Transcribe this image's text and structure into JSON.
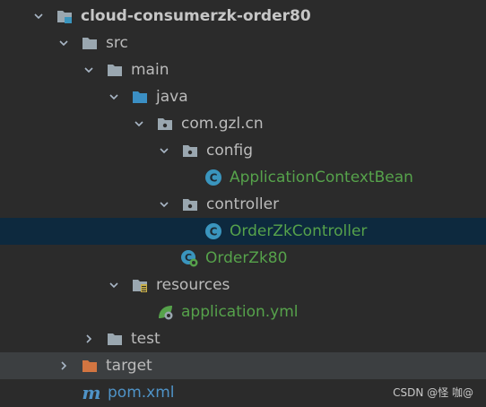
{
  "project_tree": {
    "module": {
      "label": "cloud-consumerzk-order80"
    },
    "src": {
      "label": "src"
    },
    "main": {
      "label": "main"
    },
    "java": {
      "label": "java"
    },
    "package": {
      "label": "com.gzl.cn"
    },
    "config": {
      "label": "config"
    },
    "application_context_bean": {
      "label": "ApplicationContextBean"
    },
    "controller": {
      "label": "controller"
    },
    "order_zk_controller": {
      "label": "OrderZkController"
    },
    "order_zk80": {
      "label": "OrderZk80"
    },
    "resources": {
      "label": "resources"
    },
    "application_yml": {
      "label": "application.yml"
    },
    "test": {
      "label": "test"
    },
    "target": {
      "label": "target"
    },
    "pom": {
      "label": "pom.xml",
      "icon_text": "m"
    }
  },
  "watermark": "CSDN @怪 咖@",
  "colors": {
    "background": "#2b2b2b",
    "selected_row": "#0d293e",
    "excluded_row": "#3c3f41",
    "folder": "#9aa7b0",
    "source_root": "#3b8fc4",
    "target_folder": "#d27541",
    "class_icon": "#3a95be",
    "green_text": "#56a24b",
    "pom_text": "#4f93c7"
  }
}
